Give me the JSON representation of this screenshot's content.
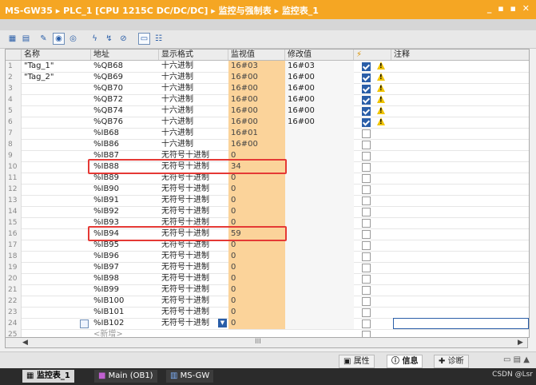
{
  "title": {
    "project": "MS-GW35",
    "plc": "PLC_1 [CPU 1215C DC/DC/DC]",
    "folder": "监控与强制表",
    "table": "监控表_1",
    "separator": "▸",
    "window_controls": "_ ▪ ▪ ✕"
  },
  "toolbar_icons": [
    "insert-row-icon",
    "add-row-icon",
    "rename-icon",
    "monitor-all-icon",
    "monitor-once-icon",
    "modify-now-icon",
    "modify-trigger-icon",
    "disable-periphery-icon",
    "display-format-icon",
    "show-all-modify-icon"
  ],
  "columns": [
    "名称",
    "地址",
    "显示格式",
    "监视值",
    "修改值",
    "⚡",
    "注释"
  ],
  "rows": [
    {
      "i": "1",
      "name": "\"Tag_1\"",
      "addr": "%QB68",
      "fmt": "十六进制",
      "mon": "16#03",
      "mod": "16#03",
      "check": true,
      "warn": true
    },
    {
      "i": "2",
      "name": "\"Tag_2\"",
      "addr": "%QB69",
      "fmt": "十六进制",
      "mon": "16#00",
      "mod": "16#00",
      "check": true,
      "warn": true
    },
    {
      "i": "3",
      "name": "",
      "addr": "%QB70",
      "fmt": "十六进制",
      "mon": "16#00",
      "mod": "16#00",
      "check": true,
      "warn": true
    },
    {
      "i": "4",
      "name": "",
      "addr": "%QB72",
      "fmt": "十六进制",
      "mon": "16#00",
      "mod": "16#00",
      "check": true,
      "warn": true
    },
    {
      "i": "5",
      "name": "",
      "addr": "%QB74",
      "fmt": "十六进制",
      "mon": "16#00",
      "mod": "16#00",
      "check": true,
      "warn": true
    },
    {
      "i": "6",
      "name": "",
      "addr": "%QB76",
      "fmt": "十六进制",
      "mon": "16#00",
      "mod": "16#00",
      "check": true,
      "warn": true
    },
    {
      "i": "7",
      "name": "",
      "addr": "%IB68",
      "fmt": "十六进制",
      "mon": "16#01",
      "mod": "",
      "check": false,
      "warn": false
    },
    {
      "i": "8",
      "name": "",
      "addr": "%IB86",
      "fmt": "十六进制",
      "mon": "16#00",
      "mod": "",
      "check": false,
      "warn": false
    },
    {
      "i": "9",
      "name": "",
      "addr": "%IB87",
      "fmt": "无符号十进制",
      "mon": "0",
      "mod": "",
      "check": false,
      "warn": false
    },
    {
      "i": "10",
      "name": "",
      "addr": "%IB88",
      "fmt": "无符号十进制",
      "mon": "34",
      "mod": "",
      "check": false,
      "warn": false
    },
    {
      "i": "11",
      "name": "",
      "addr": "%IB89",
      "fmt": "无符号十进制",
      "mon": "0",
      "mod": "",
      "check": false,
      "warn": false
    },
    {
      "i": "12",
      "name": "",
      "addr": "%IB90",
      "fmt": "无符号十进制",
      "mon": "0",
      "mod": "",
      "check": false,
      "warn": false
    },
    {
      "i": "13",
      "name": "",
      "addr": "%IB91",
      "fmt": "无符号十进制",
      "mon": "0",
      "mod": "",
      "check": false,
      "warn": false
    },
    {
      "i": "14",
      "name": "",
      "addr": "%IB92",
      "fmt": "无符号十进制",
      "mon": "0",
      "mod": "",
      "check": false,
      "warn": false
    },
    {
      "i": "15",
      "name": "",
      "addr": "%IB93",
      "fmt": "无符号十进制",
      "mon": "0",
      "mod": "",
      "check": false,
      "warn": false
    },
    {
      "i": "16",
      "name": "",
      "addr": "%IB94",
      "fmt": "无符号十进制",
      "mon": "59",
      "mod": "",
      "check": false,
      "warn": false
    },
    {
      "i": "17",
      "name": "",
      "addr": "%IB95",
      "fmt": "无符号十进制",
      "mon": "0",
      "mod": "",
      "check": false,
      "warn": false
    },
    {
      "i": "18",
      "name": "",
      "addr": "%IB96",
      "fmt": "无符号十进制",
      "mon": "0",
      "mod": "",
      "check": false,
      "warn": false
    },
    {
      "i": "19",
      "name": "",
      "addr": "%IB97",
      "fmt": "无符号十进制",
      "mon": "0",
      "mod": "",
      "check": false,
      "warn": false
    },
    {
      "i": "20",
      "name": "",
      "addr": "%IB98",
      "fmt": "无符号十进制",
      "mon": "0",
      "mod": "",
      "check": false,
      "warn": false
    },
    {
      "i": "21",
      "name": "",
      "addr": "%IB99",
      "fmt": "无符号十进制",
      "mon": "0",
      "mod": "",
      "check": false,
      "warn": false
    },
    {
      "i": "22",
      "name": "",
      "addr": "%IB100",
      "fmt": "无符号十进制",
      "mon": "0",
      "mod": "",
      "check": false,
      "warn": false
    },
    {
      "i": "23",
      "name": "",
      "addr": "%IB101",
      "fmt": "无符号十进制",
      "mon": "0",
      "mod": "",
      "check": false,
      "warn": false
    },
    {
      "i": "24",
      "name": "",
      "addr": "%IB102",
      "fmt": "无符号十进制",
      "mon": "0",
      "mod": "",
      "check": false,
      "warn": false,
      "editing": true
    },
    {
      "i": "25",
      "name": "",
      "addr": "<新增>",
      "fmt": "",
      "mon": "",
      "mod": "",
      "check": false,
      "warn": false,
      "placeholder": true
    }
  ],
  "highlighted_rows": [
    "10",
    "16"
  ],
  "scrollbar_mid": "III",
  "property_tabs": [
    {
      "label": "属性",
      "icon": "properties-icon",
      "active": false
    },
    {
      "label": "信息",
      "icon": "info-icon",
      "active": true
    },
    {
      "label": "诊断",
      "icon": "diagnostics-icon",
      "active": false
    }
  ],
  "taskbar": [
    {
      "label": "监控表_1",
      "active": true
    },
    {
      "label": "Main (OB1)",
      "active": false
    },
    {
      "label": "MS-GW",
      "active": false
    }
  ],
  "watermark": "CSDN @Lsr",
  "colors": {
    "title_bar": "#f5a623",
    "monitor_cell": "#fbd39a",
    "highlight_box": "#e53935",
    "check": "#2a5ea8",
    "warn": "#f0c400"
  }
}
